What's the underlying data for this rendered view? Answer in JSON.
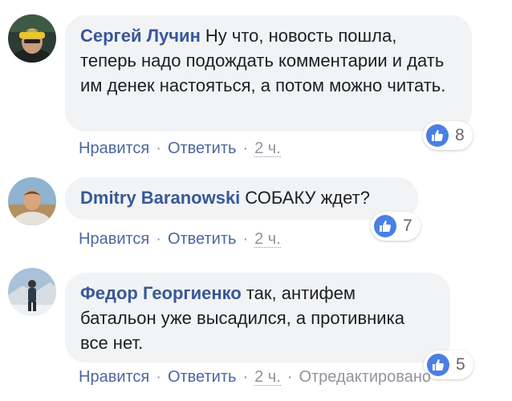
{
  "comments": [
    {
      "author": "Сергей Лучин",
      "text": "Ну что, новость пошла, теперь надо подождать комментарии и дать им денек настояться, а потом можно читать.",
      "reaction_count": "8",
      "like_label": "Нравится",
      "reply_label": "Ответить",
      "time": "2 ч."
    },
    {
      "author": "Dmitry Baranowski",
      "text": "СОБАКУ ждет?",
      "reaction_count": "7",
      "like_label": "Нравится",
      "reply_label": "Ответить",
      "time": "2 ч."
    },
    {
      "author": "Федор Георгиенко",
      "text": "так, антифем батальон уже высадился, а противника все нет.",
      "reaction_count": "5",
      "like_label": "Нравится",
      "reply_label": "Ответить",
      "time": "2 ч.",
      "edited_label": "Отредактировано"
    }
  ],
  "separator": "·",
  "colors": {
    "author": "#385898",
    "action_link": "#4b67a1",
    "muted": "#90949c",
    "bubble": "#f2f3f5",
    "like_badge": "#4a7fe4"
  },
  "icons": {
    "reaction": "thumbs-up-icon"
  }
}
